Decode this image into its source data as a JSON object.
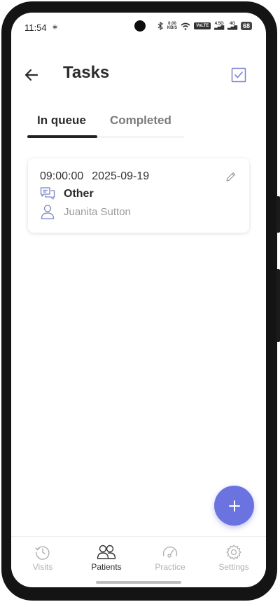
{
  "status_bar": {
    "time": "11:54",
    "net_speed_value": "0.00",
    "net_speed_unit": "KB/S",
    "volte": "VoLTE",
    "signal1_label": "4.5G",
    "signal2_label": "4G",
    "battery": "68"
  },
  "header": {
    "title": "Tasks"
  },
  "tabs": [
    {
      "label": "In queue",
      "active": true
    },
    {
      "label": "Completed",
      "active": false
    }
  ],
  "tasks": [
    {
      "time": "09:00:00",
      "date": "2025-09-19",
      "type": "Other",
      "patient": "Juanita Sutton"
    }
  ],
  "fab": {
    "icon": "plus-icon"
  },
  "bottom_nav": [
    {
      "label": "Visits",
      "icon": "history-icon",
      "active": false
    },
    {
      "label": "Patients",
      "icon": "people-icon",
      "active": true
    },
    {
      "label": "Practice",
      "icon": "gauge-icon",
      "active": false
    },
    {
      "label": "Settings",
      "icon": "gear-icon",
      "active": false
    }
  ],
  "colors": {
    "accent": "#6b73e0",
    "icon_stroke": "#7a82c9",
    "text_dark": "#2c2c2c",
    "text_muted": "#9a9a9a"
  }
}
